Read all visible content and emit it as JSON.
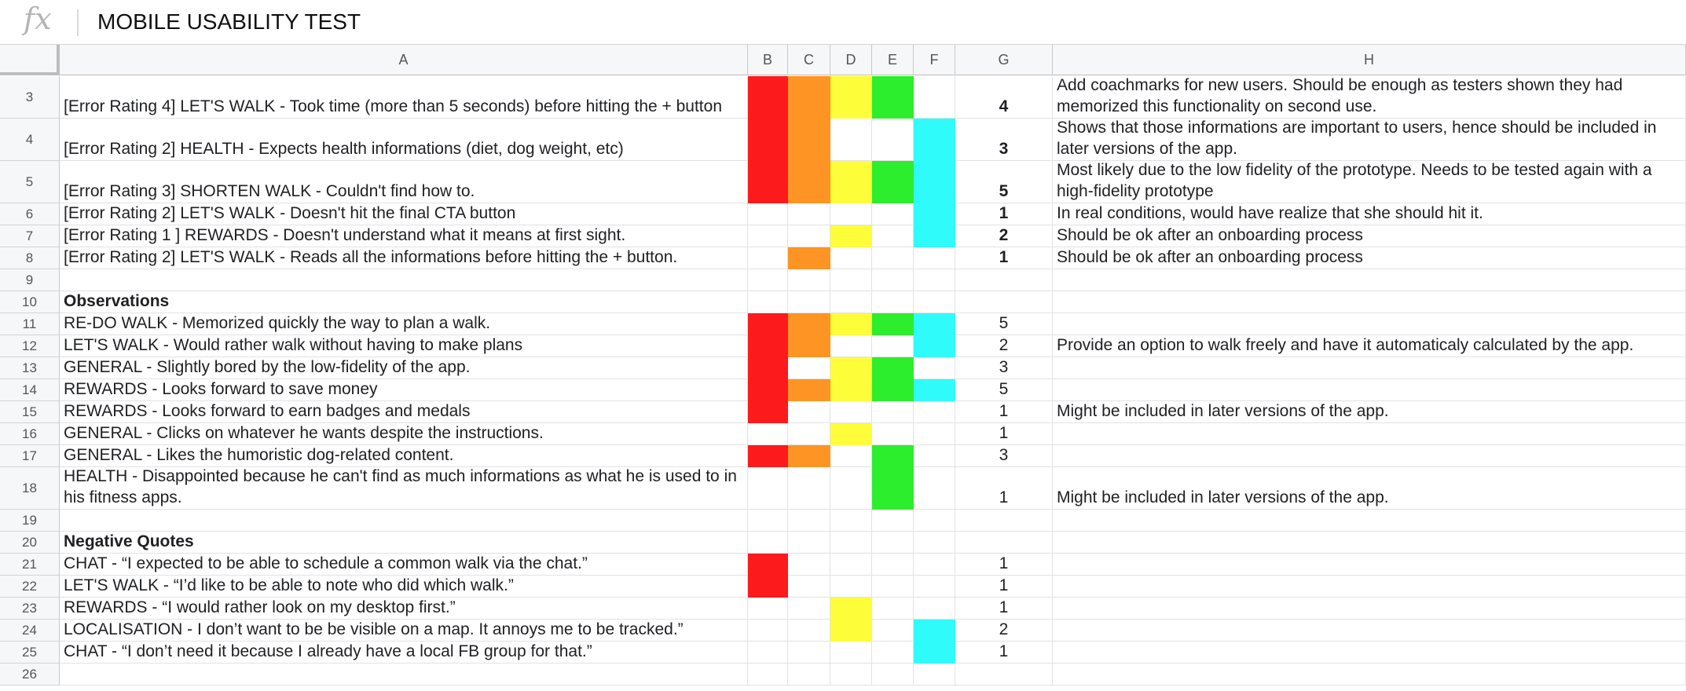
{
  "formula_bar": {
    "fx_label": "fx",
    "content": "MOBILE USABILITY TEST"
  },
  "colors": {
    "B": "#fc1a1c",
    "C": "#fd9423",
    "D": "#fdfd3a",
    "E": "#2cee2c",
    "F": "#30fbfb"
  },
  "columns": [
    "A",
    "B",
    "C",
    "D",
    "E",
    "F",
    "G",
    "H"
  ],
  "rows": [
    {
      "n": "3",
      "a": "[Error Rating 4] LET'S WALK - Took time (more than 5 seconds) before hitting the + button",
      "fill": [
        "B",
        "C",
        "D",
        "E"
      ],
      "g": "4",
      "g_bold": true,
      "h": "Add coachmarks for new users. Should be enough as testers shown they had memorized this functionality on second use."
    },
    {
      "n": "4",
      "a": "[Error Rating 2]  HEALTH - Expects health informations (diet, dog weight, etc)",
      "fill": [
        "B",
        "C",
        "F"
      ],
      "g": "3",
      "g_bold": true,
      "h": "Shows that those informations are important to users, hence should be included in later versions of the app."
    },
    {
      "n": "5",
      "a": "[Error Rating 3] SHORTEN WALK - Couldn't find how to.",
      "fill": [
        "B",
        "C",
        "D",
        "E",
        "F"
      ],
      "g": "5",
      "g_bold": true,
      "h": "Most likely due to the low fidelity of the prototype. Needs to be tested again with a high-fidelity prototype"
    },
    {
      "n": "6",
      "a": "[Error Rating 2] LET'S WALK - Doesn't hit the final CTA button",
      "fill": [
        "F"
      ],
      "g": "1",
      "g_bold": true,
      "h": "In real conditions, would have realize that she should hit it."
    },
    {
      "n": "7",
      "a": "[Error Rating 1 ] REWARDS - Doesn't understand what it means at first sight.",
      "fill": [
        "D",
        "F"
      ],
      "g": "2",
      "g_bold": true,
      "h": "Should be ok after an onboarding process"
    },
    {
      "n": "8",
      "a": "[Error Rating 2] LET'S WALK - Reads all the informations before hitting the + button.",
      "fill": [
        "C"
      ],
      "g": "1",
      "g_bold": true,
      "h": "Should be ok after an onboarding process"
    },
    {
      "n": "9",
      "a": "",
      "fill": [],
      "g": "",
      "h": ""
    },
    {
      "n": "10",
      "a": "Observations",
      "a_bold": true,
      "fill": [],
      "g": "",
      "h": ""
    },
    {
      "n": "11",
      "a": "RE-DO WALK - Memorized quickly the way to plan a walk.",
      "fill": [
        "B",
        "C",
        "D",
        "E",
        "F"
      ],
      "g": "5",
      "h": ""
    },
    {
      "n": "12",
      "a": "LET'S WALK - Would rather walk without having to make plans",
      "fill": [
        "B",
        "C",
        "F"
      ],
      "g": "2",
      "h": "Provide an option to walk freely and have it automaticaly calculated by the app."
    },
    {
      "n": "13",
      "a": "GENERAL - Slightly bored by the low-fidelity of the app.",
      "fill": [
        "B",
        "D",
        "E"
      ],
      "g": "3",
      "h": ""
    },
    {
      "n": "14",
      "a": "REWARDS - Looks forward to save money",
      "fill": [
        "B",
        "C",
        "D",
        "E",
        "F"
      ],
      "g": "5",
      "h": ""
    },
    {
      "n": "15",
      "a": "REWARDS - Looks forward to earn badges and medals",
      "fill": [
        "B"
      ],
      "g": "1",
      "h": "Might be included in later versions of the app."
    },
    {
      "n": "16",
      "a": "GENERAL - Clicks on whatever he wants despite the instructions.",
      "fill": [
        "D"
      ],
      "g": "1",
      "h": ""
    },
    {
      "n": "17",
      "a": "GENERAL - Likes the humoristic dog-related content.",
      "fill": [
        "B",
        "C",
        "E"
      ],
      "g": "3",
      "h": ""
    },
    {
      "n": "18",
      "a": "HEALTH - Disappointed because he can't find as much informations as what he is used to in his fitness apps.",
      "fill": [
        "E"
      ],
      "g": "1",
      "h": "Might be included in later versions of the app."
    },
    {
      "n": "19",
      "a": "",
      "fill": [],
      "g": "",
      "h": ""
    },
    {
      "n": "20",
      "a": "Negative Quotes",
      "a_bold": true,
      "fill": [],
      "g": "",
      "h": ""
    },
    {
      "n": "21",
      "a": "CHAT - “I expected to be able to schedule a common walk via the chat.”",
      "fill": [
        "B"
      ],
      "g": "1",
      "h": ""
    },
    {
      "n": "22",
      "a": "LET'S WALK - “I’d like to be able to note who did which walk.”",
      "fill": [
        "B"
      ],
      "g": "1",
      "h": ""
    },
    {
      "n": "23",
      "a": "REWARDS - “I would rather look on my desktop first.”",
      "fill": [
        "D"
      ],
      "g": "1",
      "h": ""
    },
    {
      "n": "24",
      "a": "LOCALISATION - I don’t want to be be visible on a map. It annoys me to be tracked.”",
      "fill": [
        "D",
        "F"
      ],
      "g": "2",
      "h": ""
    },
    {
      "n": "25",
      "a": "CHAT - “I don’t need it because I already have a local FB group for that.”",
      "fill": [
        "F"
      ],
      "g": "1",
      "h": ""
    },
    {
      "n": "26",
      "a": "",
      "fill": [],
      "g": "",
      "h": ""
    }
  ]
}
